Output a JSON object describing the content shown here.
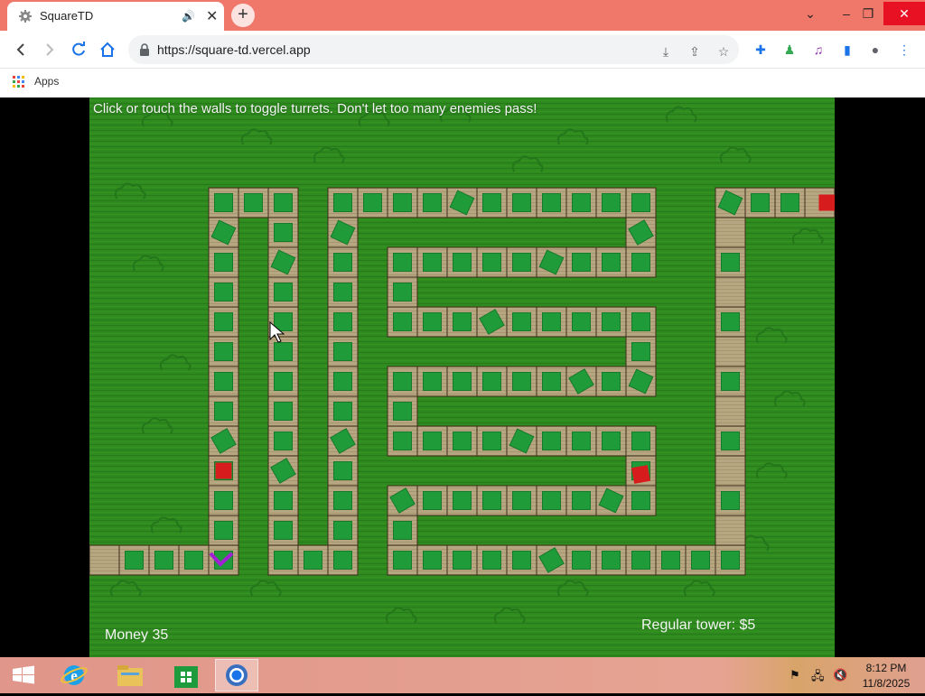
{
  "browser": {
    "tab_title": "SquareTD",
    "tab_close": "✕",
    "new_tab": "+",
    "url": "https://square-td.vercel.app",
    "bookmarks_apps": "Apps",
    "accent": "#f0786a"
  },
  "window_controls": {
    "minimize": "–",
    "restore": "❐",
    "close": "✕",
    "dropdown": "⌄"
  },
  "game": {
    "instruction": "Click or touch the walls to toggle turrets. Don't let too many enemies pass!",
    "money": "Money 35",
    "tower_info": "Regular tower: $5",
    "colors": {
      "grass": "#2d8a1d",
      "wall": "#b0a07c",
      "turret": "#1f9b3a",
      "enemy": "#d61c1c",
      "cursor_marker": "#a21fd6"
    }
  },
  "taskbar": {
    "apps": [
      "windows-start",
      "internet-explorer",
      "file-explorer",
      "store",
      "chrome"
    ],
    "time": "8:12 PM",
    "date": "11/8/2025"
  }
}
